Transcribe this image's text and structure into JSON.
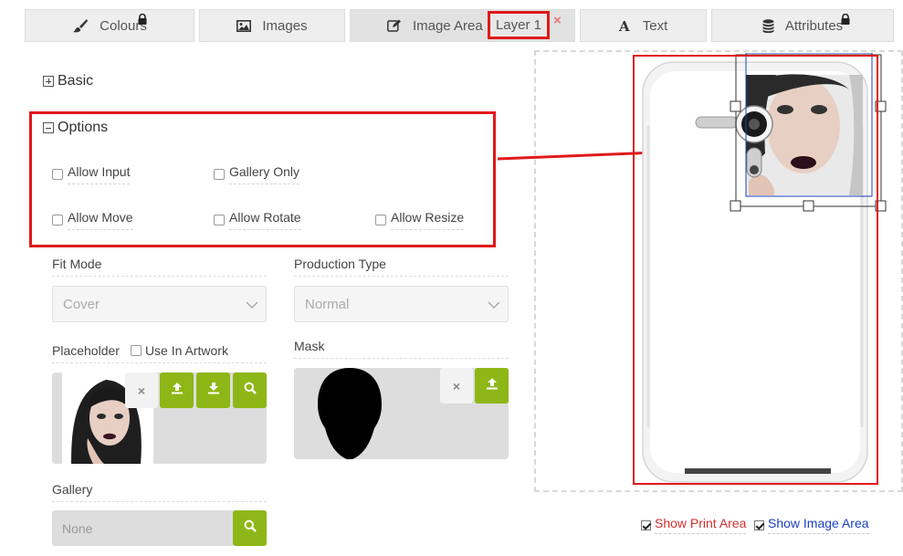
{
  "tabs": [
    {
      "label": "Colours",
      "icon": "paint-brush-icon",
      "locked": true
    },
    {
      "label": "Images",
      "icon": "picture-icon",
      "locked": false
    },
    {
      "label": "Image Area",
      "icon": "edit-icon",
      "locked": false,
      "active": true
    },
    {
      "label": "Text",
      "icon": "text-icon",
      "locked": false
    },
    {
      "label": "Attributes",
      "icon": "database-icon",
      "locked": true
    }
  ],
  "layer_badge": "Layer 1",
  "tab_close": "×",
  "sections": {
    "basic": "Basic",
    "options": "Options"
  },
  "options": {
    "allow_input": "Allow Input",
    "gallery_only": "Gallery Only",
    "allow_move": "Allow Move",
    "allow_rotate": "Allow Rotate",
    "allow_resize": "Allow Resize"
  },
  "fit_mode": {
    "label": "Fit Mode",
    "value": "Cover"
  },
  "production_type": {
    "label": "Production Type",
    "value": "Normal"
  },
  "placeholder": {
    "label": "Placeholder",
    "use_in_artwork": "Use In Artwork"
  },
  "mask": {
    "label": "Mask"
  },
  "gallery": {
    "label": "Gallery",
    "value": "None"
  },
  "remove_symbol": "×",
  "show_print_area": "Show Print Area",
  "show_image_area": "Show Image Area",
  "colors": {
    "accent_green": "#8db716",
    "highlight_red": "#e01a1a",
    "print_area_red": "#d32f2f",
    "image_area_blue": "#1a3fbf"
  }
}
